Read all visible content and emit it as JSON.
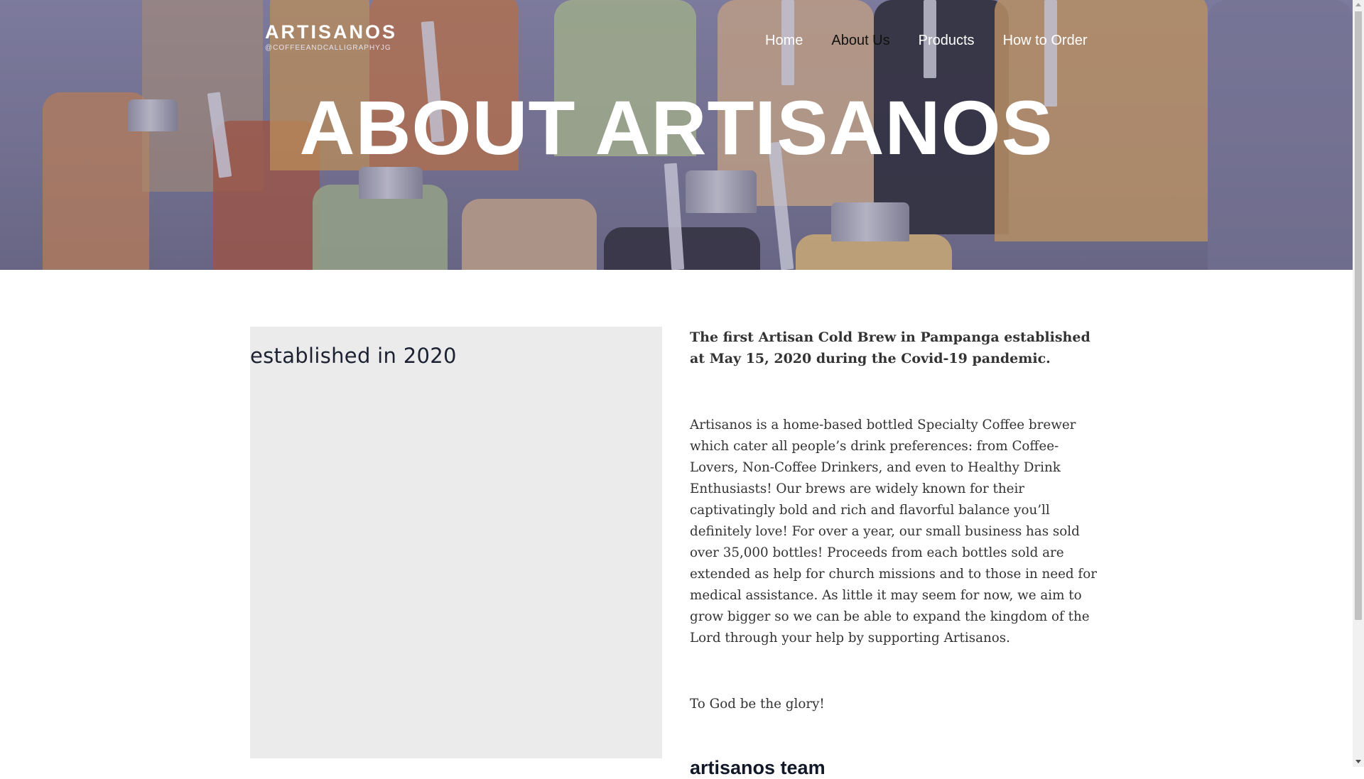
{
  "brand": {
    "name": "ARTISANOS",
    "handle": "@COFFEEANDCALLIGRAPHYJG"
  },
  "nav": {
    "items": [
      {
        "label": "Home",
        "active": false
      },
      {
        "label": "About Us",
        "active": true
      },
      {
        "label": "Products",
        "active": false
      },
      {
        "label": "How to Order",
        "active": false
      }
    ]
  },
  "hero": {
    "title": "ABOUT ARTISANOS"
  },
  "image_panel": {
    "caption": "established in 2020"
  },
  "about": {
    "intro": "The first Artisan Cold Brew in Pampanga established at May 15, 2020 during the Covid-19 pandemic.",
    "body": "Artisanos is a home-based bottled Specialty Coffee brewer which cater all people’s drink preferences: from Coffee-Lovers, Non-Coffee Drinkers, and even to Healthy Drink Enthusiasts! Our brews are widely known for their captivatingly bold and rich and flavorful balance you’ll definitely love! For over a year, our small business has sold over 35,000 bottles! Proceeds from each bottles sold are extended as help for church missions and to those in need for medical assistance. As little it may seem for now, we aim to grow bigger so we can be able to expand the kingdom of the Lord through your help by supporting Artisanos.",
    "closing": "To God be the glory!",
    "team_heading": "artisanos team"
  },
  "icons": {
    "scroll_up": "scroll-up-arrow-icon",
    "scroll_down": "scroll-down-arrow-icon"
  }
}
